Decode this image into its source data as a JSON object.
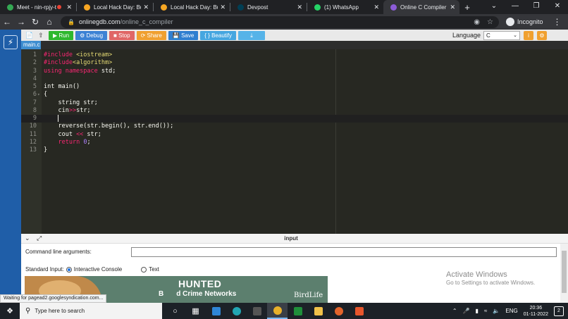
{
  "browser": {
    "tabs": [
      {
        "title": "Meet - nin-rpjy-t",
        "fav": "#34a853",
        "recording": true,
        "active": false
      },
      {
        "title": "Local Hack Day: Build",
        "fav": "#f6a623",
        "recording": false,
        "active": false
      },
      {
        "title": "Local Hack Day: Build",
        "fav": "#f6a623",
        "recording": false,
        "active": false
      },
      {
        "title": "Devpost",
        "fav": "#003e54",
        "recording": false,
        "active": false
      },
      {
        "title": "(1) WhatsApp",
        "fav": "#25d366",
        "recording": false,
        "active": false
      },
      {
        "title": "Online C Compiler - o",
        "fav": "#8c5cd6",
        "recording": false,
        "active": true
      }
    ],
    "url_host": "onlinegdb.com",
    "url_path": "/online_c_compiler",
    "profile_label": "Incognito"
  },
  "toolbar": {
    "run": "Run",
    "debug": "Debug",
    "stop": "Stop",
    "share": "Share",
    "save": "Save",
    "beautify": "{ } Beautify",
    "language_label": "Language",
    "language_value": "C"
  },
  "file_tab": "main.c",
  "code_lines": [
    {
      "n": "1",
      "fold": false,
      "tokens": [
        {
          "c": "k",
          "t": "#include "
        },
        {
          "c": "s",
          "t": "<iostream>"
        }
      ]
    },
    {
      "n": "2",
      "fold": false,
      "tokens": [
        {
          "c": "k",
          "t": "#include"
        },
        {
          "c": "s",
          "t": "<algorithm>"
        }
      ]
    },
    {
      "n": "3",
      "fold": false,
      "tokens": [
        {
          "c": "k",
          "t": "using namespace "
        },
        {
          "c": "",
          "t": "std;"
        }
      ]
    },
    {
      "n": "4",
      "fold": false,
      "tokens": []
    },
    {
      "n": "5",
      "fold": false,
      "tokens": [
        {
          "c": "",
          "t": "int main()"
        }
      ]
    },
    {
      "n": "6",
      "fold": true,
      "tokens": [
        {
          "c": "",
          "t": "{"
        }
      ]
    },
    {
      "n": "7",
      "fold": false,
      "tokens": [
        {
          "c": "",
          "t": "    string str;"
        }
      ]
    },
    {
      "n": "8",
      "fold": false,
      "tokens": [
        {
          "c": "",
          "t": "    cin"
        },
        {
          "c": "k",
          "t": ">>"
        },
        {
          "c": "",
          "t": "str;"
        }
      ]
    },
    {
      "n": "9",
      "fold": false,
      "current": true,
      "tokens": [
        {
          "c": "",
          "t": "    "
        }
      ]
    },
    {
      "n": "10",
      "fold": false,
      "tokens": [
        {
          "c": "",
          "t": "    reverse(str.begin(), str.end());"
        }
      ]
    },
    {
      "n": "11",
      "fold": false,
      "tokens": [
        {
          "c": "",
          "t": "    cout "
        },
        {
          "c": "k",
          "t": "<<"
        },
        {
          "c": "",
          "t": " str;"
        }
      ]
    },
    {
      "n": "12",
      "fold": false,
      "tokens": [
        {
          "c": "",
          "t": "    "
        },
        {
          "c": "k",
          "t": "return "
        },
        {
          "c": "n",
          "t": "0"
        },
        {
          "c": "",
          "t": ";"
        }
      ]
    },
    {
      "n": "13",
      "fold": false,
      "tokens": [
        {
          "c": "",
          "t": "}"
        }
      ]
    }
  ],
  "panel": {
    "title": "input",
    "cmd_label": "Command line arguments:",
    "stdin_label": "Standard Input:",
    "opt_interactive": "Interactive Console",
    "opt_text": "Text"
  },
  "ad": {
    "headline": "HUNTED",
    "subline_prefix": "B",
    "subline": "d Crime Networks",
    "brand": "BirdLife"
  },
  "watermark": {
    "line1": "Activate Windows",
    "line2": "Go to Settings to activate Windows."
  },
  "status_text": "Waiting for pagead2.googlesyndication.com...",
  "taskbar": {
    "search_placeholder": "Type here to search",
    "lang": "ENG",
    "time": "20:36",
    "date": "01-11-2022",
    "notif_count": "2"
  }
}
